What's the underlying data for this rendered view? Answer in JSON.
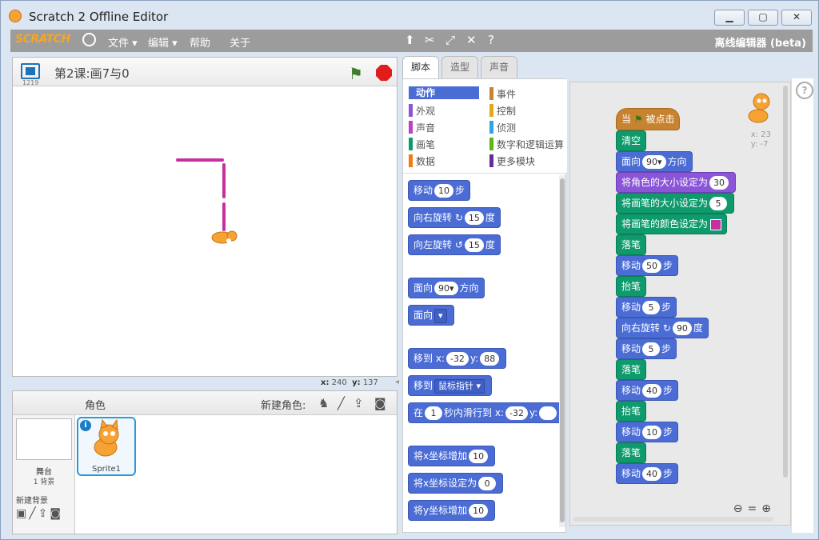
{
  "window": {
    "title": "Scratch 2 Offline Editor",
    "min": "▁",
    "max": "▢",
    "close": "✕"
  },
  "menubar": {
    "logo": "SCRATCH",
    "file": "文件",
    "edit": "编辑",
    "help": "帮助",
    "about": "关于",
    "mode": "离线编辑器 (beta)"
  },
  "stage": {
    "title": "第2课:画7与0",
    "version": "1219",
    "x_label": "x:",
    "x_value": "240",
    "y_label": "y:",
    "y_value": "137"
  },
  "sprites": {
    "header": "角色",
    "new_sprite": "新建角色:",
    "stage_name": "舞台",
    "bg_count": "1 背景",
    "new_bg": "新建背景",
    "sprite1_name": "Sprite1"
  },
  "tabs": [
    {
      "label": "脚本"
    },
    {
      "label": "造型"
    },
    {
      "label": "声音"
    }
  ],
  "categories": [
    {
      "label": "动作",
      "color": "#4a6cd4"
    },
    {
      "label": "事件",
      "color": "#c88330"
    },
    {
      "label": "外观",
      "color": "#8a55d7"
    },
    {
      "label": "控制",
      "color": "#e1a91a"
    },
    {
      "label": "声音",
      "color": "#bb42c3"
    },
    {
      "label": "侦测",
      "color": "#2ca5e2"
    },
    {
      "label": "画笔",
      "color": "#0e9a6c"
    },
    {
      "label": "数字和逻辑运算",
      "color": "#5cb712"
    },
    {
      "label": "数据",
      "color": "#ee7d16"
    },
    {
      "label": "更多模块",
      "color": "#632d99"
    }
  ],
  "palette": {
    "move": "移动",
    "move_n": "10",
    "steps": "步",
    "turn_right": "向右旋转",
    "turn_right_n": "15",
    "deg": "度",
    "turn_left": "向左旋转",
    "turn_left_n": "15",
    "point_dir": "面向",
    "point_dir_n": "90",
    "direction": "方向",
    "point_towards": "面向",
    "goto_xy": "移到 x:",
    "goto_x": "-32",
    "goto_y_label": "y:",
    "goto_y": "88",
    "goto": "移到",
    "goto_target": "鼠标指针",
    "glide": "在",
    "glide_n": "1",
    "glide_mid": "秒内滑行到 x:",
    "glide_x": "-32",
    "glide_y_label": "y:",
    "change_x": "将x坐标增加",
    "change_x_n": "10",
    "set_x": "将x坐标设定为",
    "set_x_n": "0",
    "change_y": "将y坐标增加",
    "change_y_n": "10"
  },
  "script": {
    "hat_when": "当",
    "hat_clicked": "被点击",
    "clear": "清空",
    "point_dir": "面向",
    "point_dir_n": "90",
    "direction": "方向",
    "set_size": "将角色的大小设定为",
    "set_size_n": "30",
    "pen_size": "将画笔的大小设定为",
    "pen_size_n": "5",
    "pen_color": "将画笔的颜色设定为",
    "pen_down": "落笔",
    "pen_up": "抬笔",
    "move": "移动",
    "steps": "步",
    "m1": "50",
    "m2": "5",
    "turn": "向右旋转",
    "turn_n": "90",
    "deg": "度",
    "m3": "5",
    "m4": "40",
    "m5": "10",
    "m6": "40",
    "sprite_x": "x: 23",
    "sprite_y": "y: -7"
  }
}
